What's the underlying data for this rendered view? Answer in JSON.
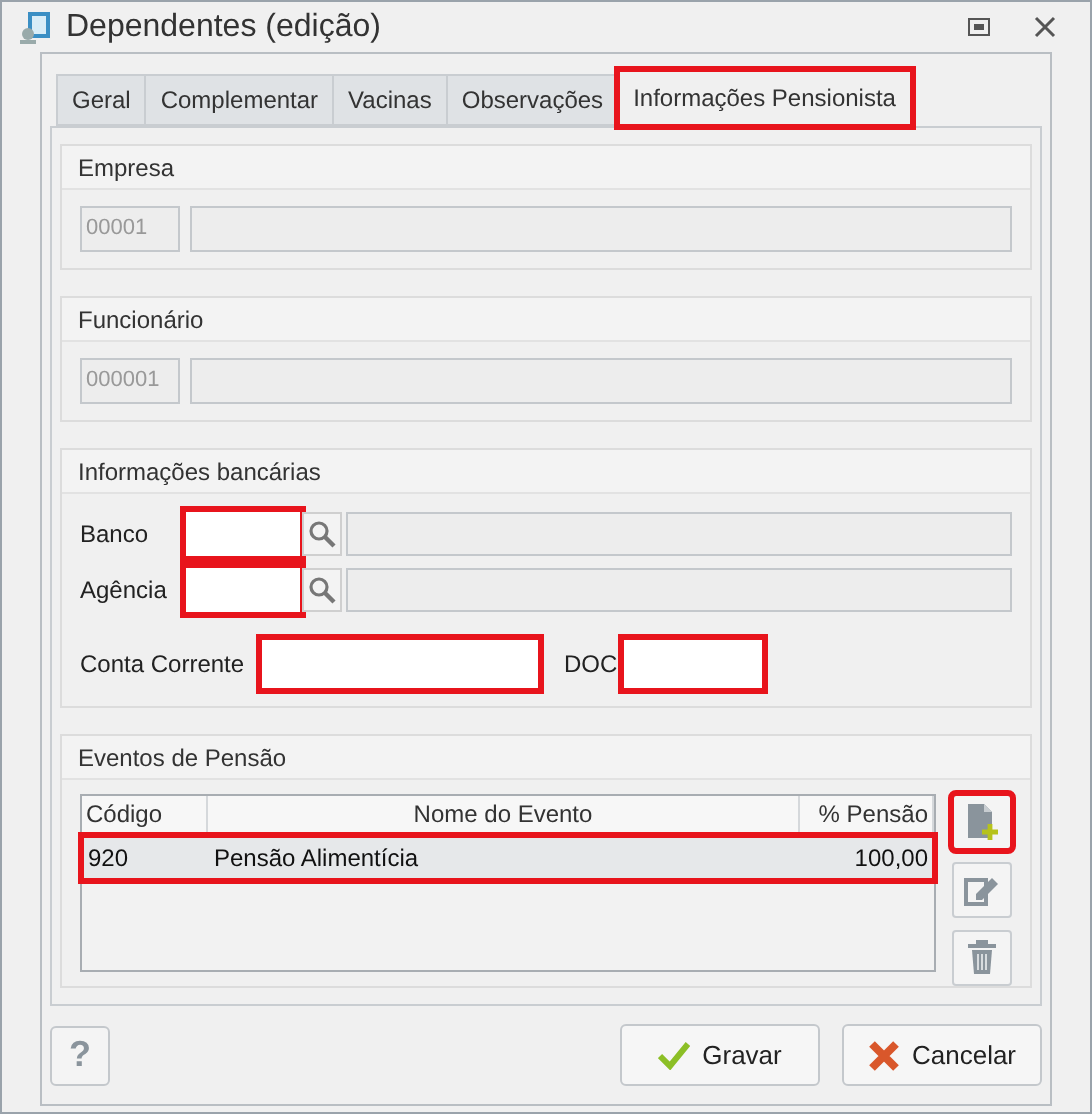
{
  "window": {
    "title": "Dependentes (edição)"
  },
  "tabs": [
    {
      "label": "Geral",
      "selected": false,
      "highlighted": false
    },
    {
      "label": "Complementar",
      "selected": false,
      "highlighted": false
    },
    {
      "label": "Vacinas",
      "selected": false,
      "highlighted": false
    },
    {
      "label": "Observações",
      "selected": false,
      "highlighted": false
    },
    {
      "label": "Informações Pensionista",
      "selected": true,
      "highlighted": true
    }
  ],
  "empresa": {
    "title": "Empresa",
    "code": "00001"
  },
  "funcionario": {
    "title": "Funcionário",
    "code": "000001"
  },
  "bank": {
    "title": "Informações bancárias",
    "lookups": [
      {
        "label": "Banco",
        "highlighted": true
      },
      {
        "label": "Agência",
        "highlighted": true
      }
    ],
    "account": {
      "label": "Conta Corrente",
      "highlighted": true
    },
    "doc": {
      "label": "DOC",
      "highlighted": true
    }
  },
  "events": {
    "title": "Eventos de Pensão",
    "table": {
      "columns": [
        "Código",
        "Nome do Evento",
        "% Pensão"
      ],
      "rows": [
        {
          "cells": [
            "920",
            "Pensão Alimentícia",
            "100,00"
          ],
          "selected": true,
          "highlighted": true
        }
      ]
    },
    "actions": [
      {
        "kind": "add",
        "highlighted": true
      },
      {
        "kind": "edit",
        "highlighted": false
      },
      {
        "kind": "delete",
        "highlighted": false
      }
    ]
  },
  "footer": {
    "help": "?",
    "buttons": [
      {
        "kind": "save",
        "label": "Gravar"
      },
      {
        "kind": "cancel",
        "label": "Cancelar"
      }
    ]
  }
}
